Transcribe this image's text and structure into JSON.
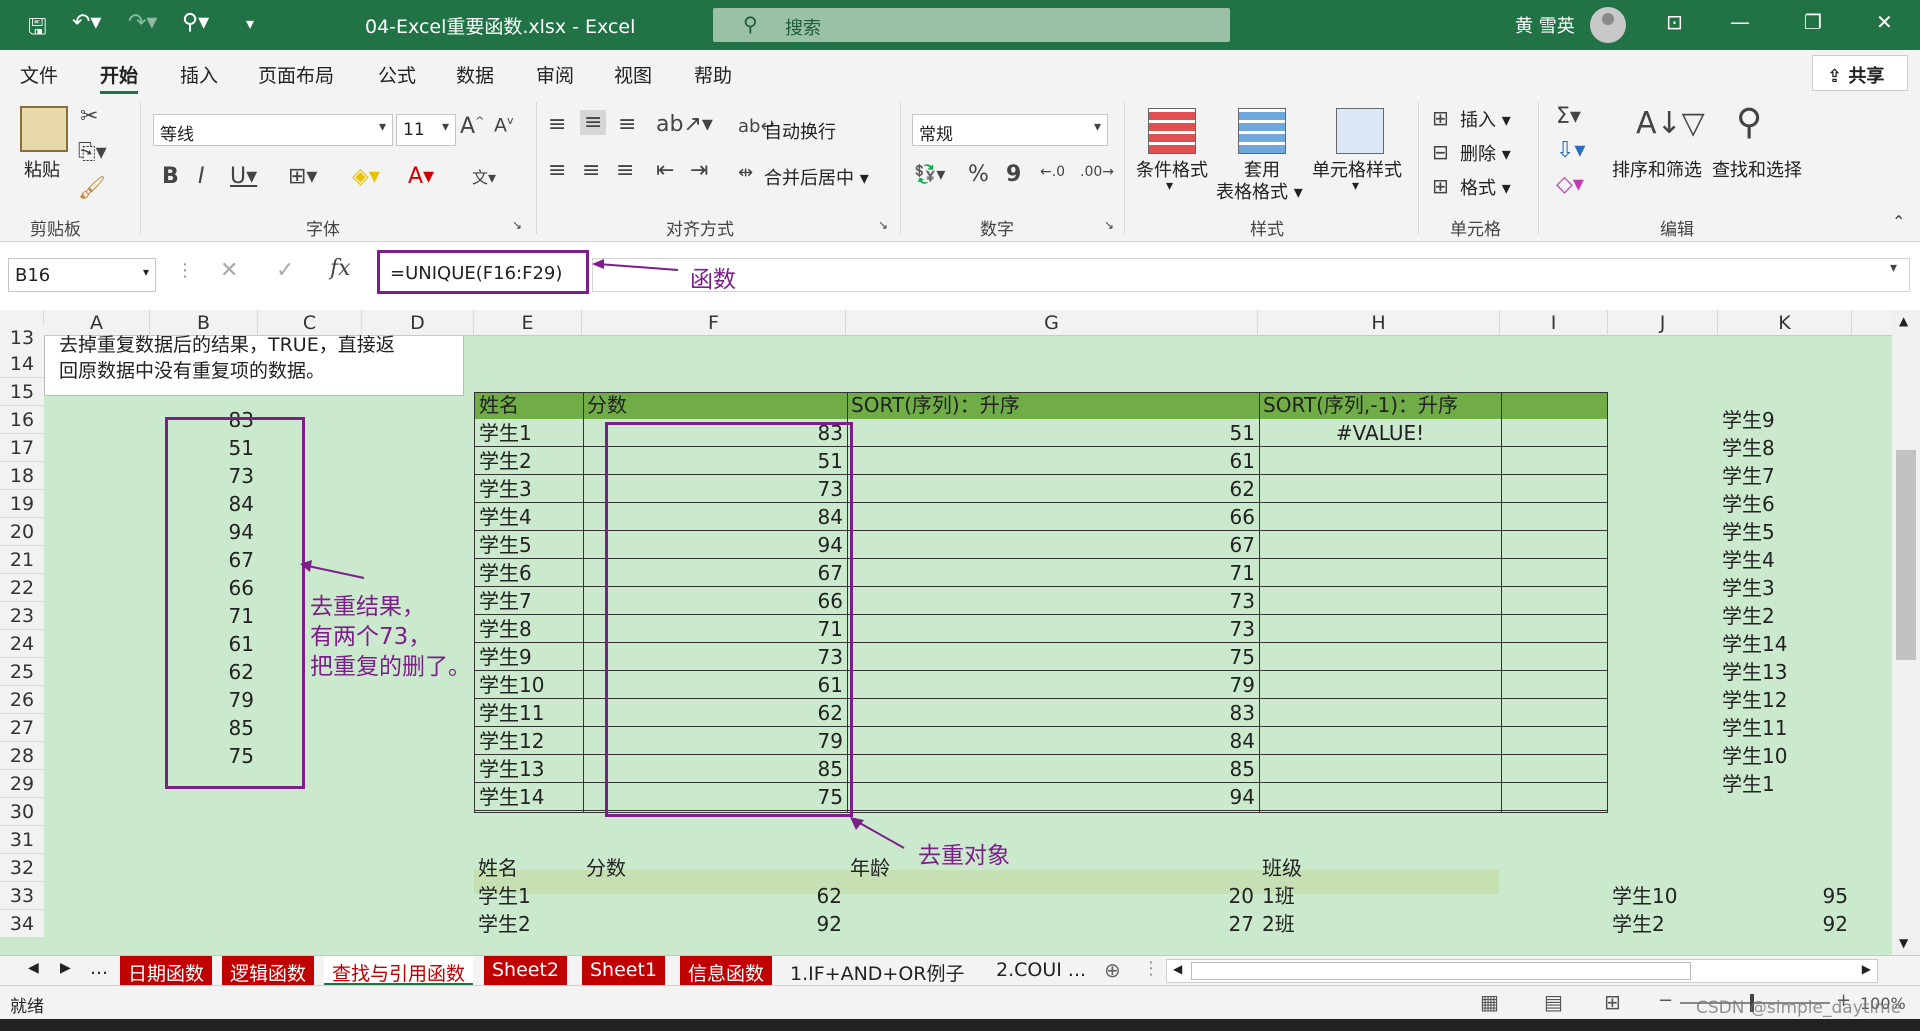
{
  "titlebar": {
    "filename": "04-Excel重要函数.xlsx",
    "app": "Excel",
    "search_placeholder": "搜索",
    "user": "黄 雪英"
  },
  "menu": {
    "items": [
      "文件",
      "开始",
      "插入",
      "页面布局",
      "公式",
      "数据",
      "审阅",
      "视图",
      "帮助"
    ],
    "share": "共享"
  },
  "ribbon": {
    "clipboard": {
      "paste": "粘贴",
      "group": "剪贴板"
    },
    "font": {
      "name": "等线",
      "size": "11",
      "group": "字体"
    },
    "align": {
      "wrap": "自动换行",
      "merge": "合并后居中",
      "group": "对齐方式"
    },
    "number": {
      "format": "常规",
      "group": "数字"
    },
    "styles": {
      "cond": "条件格式",
      "table_l1": "套用",
      "table_l2": "表格格式",
      "cell": "单元格样式",
      "group": "样式"
    },
    "cells": {
      "insert": "插入",
      "delete": "删除",
      "format": "格式",
      "group": "单元格"
    },
    "edit": {
      "sort": "排序和筛选",
      "find": "查找和选择",
      "group": "编辑"
    }
  },
  "formula_bar": {
    "name_box": "B16",
    "formula": "=UNIQUE(F16:F29)",
    "annotation": "函数"
  },
  "columns": [
    "A",
    "B",
    "C",
    "D",
    "E",
    "F",
    "G",
    "H",
    "I",
    "J",
    "K"
  ],
  "rows": [
    "13",
    "14",
    "15",
    "16",
    "17",
    "18",
    "19",
    "20",
    "21",
    "22",
    "23",
    "24",
    "25",
    "26",
    "27",
    "28",
    "29",
    "30",
    "31",
    "32",
    "33",
    "34"
  ],
  "note": {
    "line1": "去掉重复数据后的结果，TRUE，直接返",
    "line2": "回原数据中没有重复项的数据。"
  },
  "unique_result": [
    "83",
    "51",
    "73",
    "84",
    "94",
    "67",
    "66",
    "71",
    "61",
    "62",
    "79",
    "85",
    "75"
  ],
  "result_annotation": [
    "去重结果，",
    "有两个73，",
    "把重复的删了。"
  ],
  "table": {
    "headers": [
      "姓名",
      "分数",
      "SORT(序列)：升序",
      "SORT(序列,-1)：升序"
    ],
    "names": [
      "学生1",
      "学生2",
      "学生3",
      "学生4",
      "学生5",
      "学生6",
      "学生7",
      "学生8",
      "学生9",
      "学生10",
      "学生11",
      "学生12",
      "学生13",
      "学生14"
    ],
    "scores": [
      "83",
      "51",
      "73",
      "84",
      "94",
      "67",
      "66",
      "71",
      "73",
      "61",
      "62",
      "79",
      "85",
      "75"
    ],
    "sorted": [
      "51",
      "61",
      "62",
      "66",
      "67",
      "71",
      "73",
      "73",
      "75",
      "79",
      "83",
      "84",
      "85",
      "94"
    ],
    "error": "#VALUE!"
  },
  "target_annotation": "去重对象",
  "k_column": [
    "学生9",
    "学生8",
    "学生7",
    "学生6",
    "学生5",
    "学生4",
    "学生3",
    "学生2",
    "学生14",
    "学生13",
    "学生12",
    "学生11",
    "学生10",
    "学生1"
  ],
  "lower_table": {
    "headers": [
      "姓名",
      "分数",
      "年龄",
      "班级"
    ],
    "rows": [
      [
        "学生1",
        "62",
        "20",
        "1班"
      ],
      [
        "学生2",
        "92",
        "27",
        "2班"
      ]
    ],
    "j_values": [
      [
        "学生10",
        "95"
      ],
      [
        "学生2",
        "92"
      ]
    ]
  },
  "tabs": [
    "日期函数",
    "逻辑函数",
    "查找与引用函数",
    "Sheet2",
    "Sheet1",
    "信息函数",
    "1.IF+AND+OR例子",
    "2.COUI ..."
  ],
  "status": {
    "ready": "就绪",
    "zoom": "100%",
    "watermark": "CSDN @simple_daytime"
  }
}
